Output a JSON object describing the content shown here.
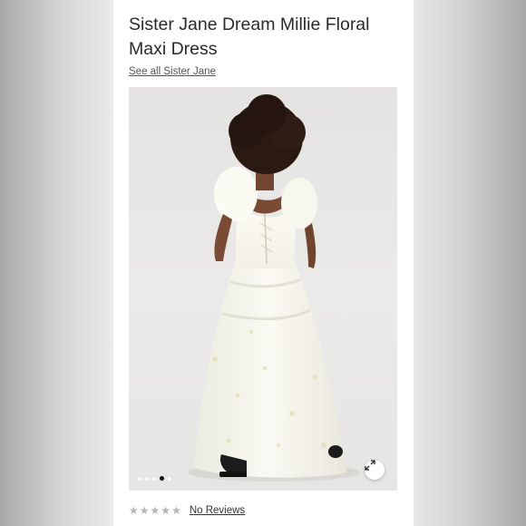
{
  "product": {
    "title": "Sister Jane Dream Millie Floral Maxi Dress",
    "brand_link": "See all Sister Jane"
  },
  "gallery": {
    "image_description_icon": "dress-photo",
    "dots_count": 5,
    "active_dot_index": 3,
    "expand_icon": "expand-arrows-icon"
  },
  "reviews": {
    "rating": 0,
    "max_rating": 5,
    "stars": [
      "★",
      "★",
      "★",
      "★",
      "★"
    ],
    "link_label": "No Reviews"
  },
  "colors": {
    "star_empty": "#b5b5b5",
    "text": "#2a2a2a",
    "active_dot": "#111111"
  }
}
